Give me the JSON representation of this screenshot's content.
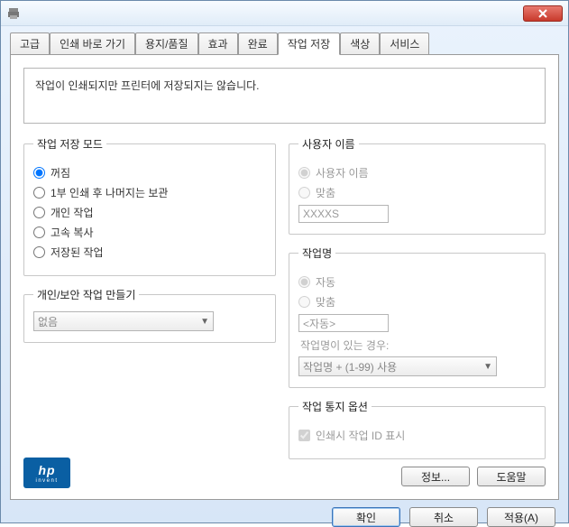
{
  "window": {
    "close_label": "Close"
  },
  "tabs": [
    {
      "label": "고급"
    },
    {
      "label": "인쇄 바로 가기"
    },
    {
      "label": "용지/품질"
    },
    {
      "label": "효과"
    },
    {
      "label": "완료"
    },
    {
      "label": "작업 저장"
    },
    {
      "label": "색상"
    },
    {
      "label": "서비스"
    }
  ],
  "active_tab_index": 5,
  "description": "작업이 인쇄되지만 프린터에 저장되지는 않습니다.",
  "mode": {
    "legend": "작업 저장 모드",
    "options": [
      {
        "label": "꺼짐",
        "checked": true
      },
      {
        "label": "1부 인쇄 후 나머지는 보관",
        "checked": false
      },
      {
        "label": "개인 작업",
        "checked": false
      },
      {
        "label": "고속 복사",
        "checked": false
      },
      {
        "label": "저장된 작업",
        "checked": false
      }
    ]
  },
  "private": {
    "legend": "개인/보안 작업 만들기",
    "select_value": "없음"
  },
  "user": {
    "legend": "사용자 이름",
    "opt_username": "사용자 이름",
    "opt_custom": "맞춤",
    "value": "XXXXS"
  },
  "jobname": {
    "legend": "작업명",
    "opt_auto": "자동",
    "opt_custom": "맞춤",
    "value": "<자동>",
    "exists_label": "작업명이 있는 경우:",
    "exists_value": "작업명 + (1-99) 사용"
  },
  "notify": {
    "legend": "작업 통지 옵션",
    "opt_showid": "인쇄시 작업 ID 표시"
  },
  "buttons": {
    "info": "정보...",
    "help": "도움말",
    "ok": "확인",
    "cancel": "취소",
    "apply": "적용(A)"
  },
  "logo": {
    "brand": "hp",
    "tag": "invent"
  }
}
